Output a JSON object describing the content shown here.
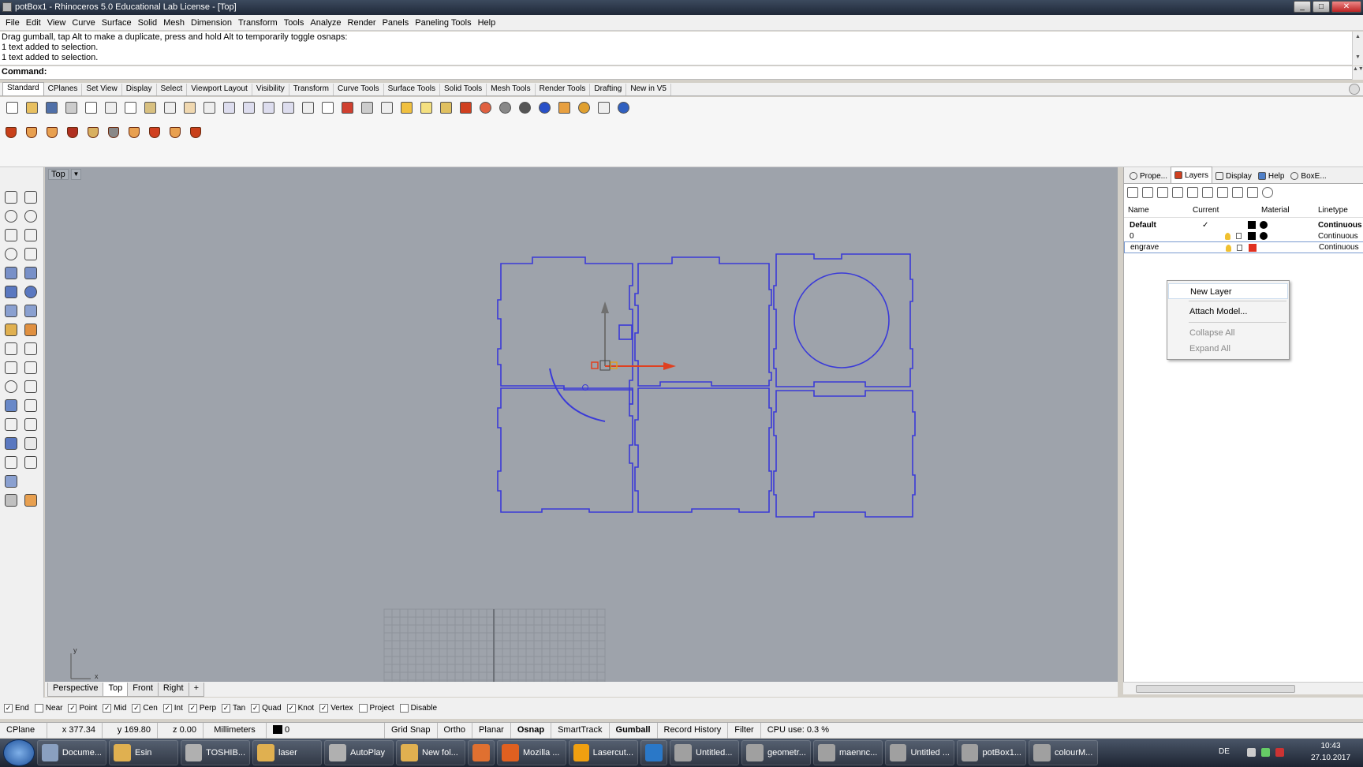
{
  "title": "potBox1 - Rhinoceros 5.0 Educational Lab License - [Top]",
  "window_buttons": [
    "_",
    "□",
    "✕"
  ],
  "menu": [
    "File",
    "Edit",
    "View",
    "Curve",
    "Surface",
    "Solid",
    "Mesh",
    "Dimension",
    "Transform",
    "Tools",
    "Analyze",
    "Render",
    "Panels",
    "Paneling Tools",
    "Help"
  ],
  "history": [
    "Drag gumball, tap Alt to make a duplicate, press and hold Alt to temporarily toggle osnaps:",
    "1 text added to selection.",
    "1 text added to selection."
  ],
  "command_label": "Command:",
  "toolbar_tabs": [
    "Standard",
    "CPlanes",
    "Set View",
    "Display",
    "Select",
    "Viewport Layout",
    "Visibility",
    "Transform",
    "Curve Tools",
    "Surface Tools",
    "Solid Tools",
    "Mesh Tools",
    "Render Tools",
    "Drafting",
    "New in V5"
  ],
  "viewport": {
    "name": "Top",
    "axis_y": "y",
    "axis_x": "x",
    "curve_color": "#3a3ad8",
    "bg": "#9ea3ab"
  },
  "view_tabs": [
    "Perspective",
    "Top",
    "Front",
    "Right",
    "+"
  ],
  "osnaps": [
    {
      "label": "End",
      "checked": true
    },
    {
      "label": "Near",
      "checked": false
    },
    {
      "label": "Point",
      "checked": true
    },
    {
      "label": "Mid",
      "checked": true
    },
    {
      "label": "Cen",
      "checked": true
    },
    {
      "label": "Int",
      "checked": true
    },
    {
      "label": "Perp",
      "checked": true
    },
    {
      "label": "Tan",
      "checked": true
    },
    {
      "label": "Quad",
      "checked": true
    },
    {
      "label": "Knot",
      "checked": true
    },
    {
      "label": "Vertex",
      "checked": true
    },
    {
      "label": "Project",
      "checked": false
    },
    {
      "label": "Disable",
      "checked": false
    }
  ],
  "status": {
    "cplane": "CPlane",
    "x": "x 377.34",
    "y": "y 169.80",
    "z": "z 0.00",
    "units": "Millimeters",
    "layer": "0",
    "grid_snap": "Grid Snap",
    "ortho": "Ortho",
    "planar": "Planar",
    "osnap": "Osnap",
    "smarttrack": "SmartTrack",
    "gumball": "Gumball",
    "record_history": "Record History",
    "filter": "Filter",
    "cpu": "CPU use: 0.3 %"
  },
  "panel": {
    "tabs": [
      "Prope...",
      "Layers",
      "Display",
      "Help",
      "BoxE..."
    ],
    "headers": {
      "name": "Name",
      "current": "Current",
      "material": "Material",
      "linetype": "Linetype"
    },
    "layers": [
      {
        "name": "Default",
        "current": "✓",
        "color": "#000000",
        "linetype": "Continuous",
        "bold": true
      },
      {
        "name": "0",
        "current": "",
        "color": "#000000",
        "linetype": "Continuous",
        "bold": false
      },
      {
        "name": "engrave",
        "current": "",
        "color": "#e03020",
        "linetype": "Continuous",
        "bold": false
      }
    ]
  },
  "context_menu": [
    {
      "label": "New Layer",
      "enabled": true
    },
    {
      "label": "Attach Model...",
      "enabled": true
    },
    {
      "label": "Collapse All",
      "enabled": false
    },
    {
      "label": "Expand All",
      "enabled": false
    }
  ],
  "taskbar": [
    {
      "label": "Docume...",
      "color": "#8aa0c0"
    },
    {
      "label": "Esin",
      "color": "#e0b050"
    },
    {
      "label": "TOSHIB...",
      "color": "#b0b0b0"
    },
    {
      "label": "laser",
      "color": "#e0b050"
    },
    {
      "label": "AutoPlay",
      "color": "#b0b0b0"
    },
    {
      "label": "New fol...",
      "color": "#e0b050"
    },
    {
      "label": "",
      "color": "#e07030"
    },
    {
      "label": "Mozilla ...",
      "color": "#e06020"
    },
    {
      "label": "Lasercut...",
      "color": "#f0a010"
    },
    {
      "label": "",
      "color": "#2a78c8"
    },
    {
      "label": "Untitled...",
      "color": "#a0a0a0"
    },
    {
      "label": "geometr...",
      "color": "#a0a0a0"
    },
    {
      "label": "maennc...",
      "color": "#a0a0a0"
    },
    {
      "label": "Untitled ...",
      "color": "#a0a0a0"
    },
    {
      "label": "potBox1...",
      "color": "#a0a0a0"
    },
    {
      "label": "colourM...",
      "color": "#a0a0a0"
    }
  ],
  "tray": {
    "lang": "DE",
    "time": "10:43",
    "date": "27.10.2017"
  }
}
